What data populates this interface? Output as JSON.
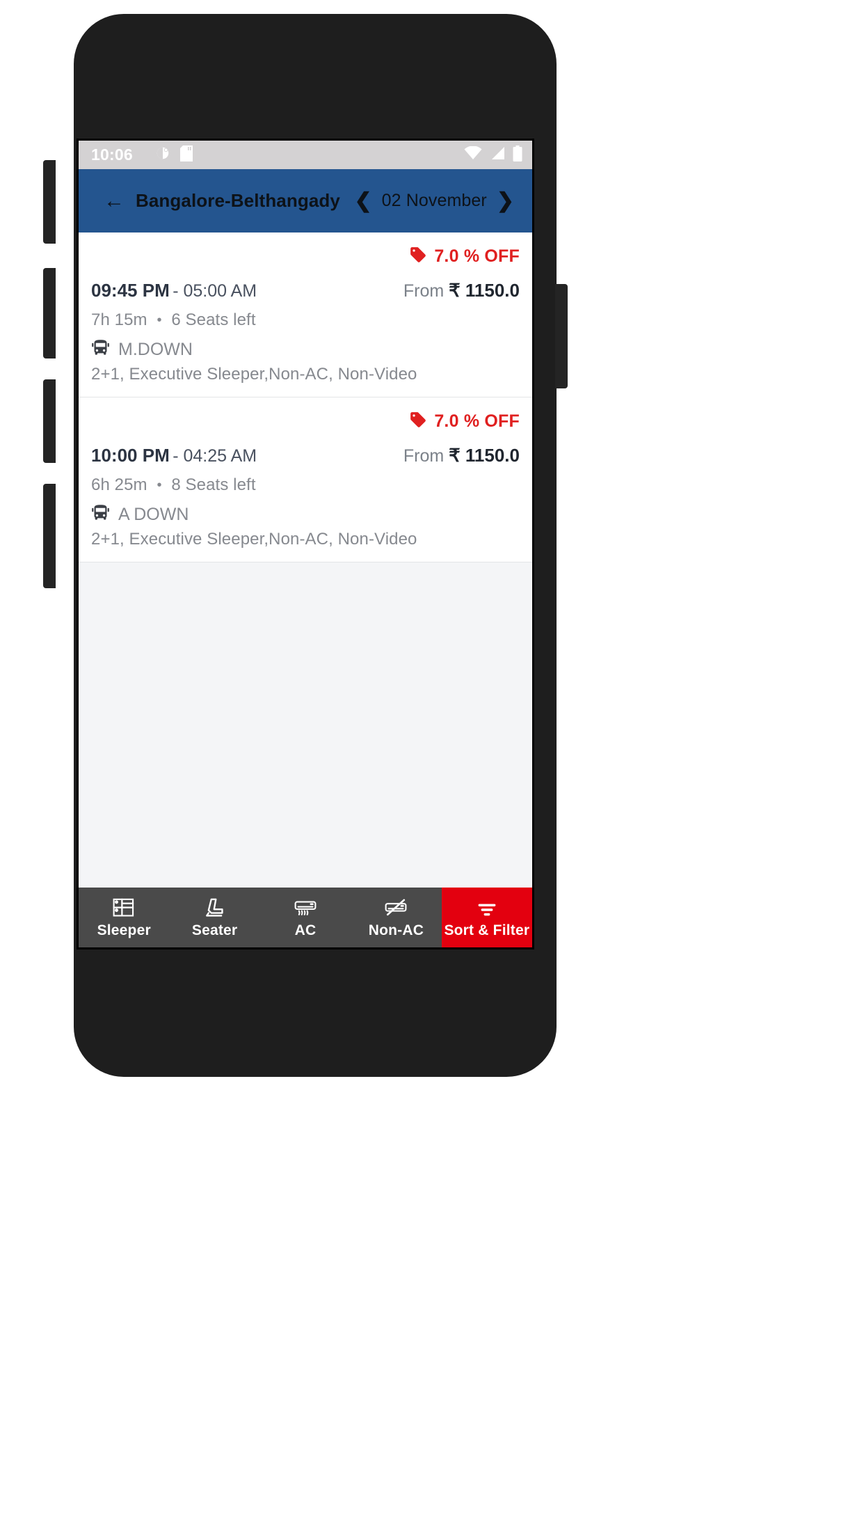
{
  "statusbar": {
    "time": "10:06",
    "left_icons": [
      "screen-rotation-icon",
      "sd-card-icon"
    ],
    "right_icons": [
      "wifi-icon",
      "cell-signal-icon",
      "battery-icon"
    ]
  },
  "appbar": {
    "back_icon": "back-arrow-icon",
    "title": "Bangalore-Belthangady",
    "prev_icon": "chevron-left-icon",
    "date": "02 November",
    "next_icon": "chevron-right-icon",
    "background_color": "#24558f"
  },
  "results": [
    {
      "offer_icon": "discount-tag-icon",
      "offer": "7.0 % OFF",
      "departure": "09:45 PM",
      "arrival": "- 05:00 AM",
      "price_prefix": "From",
      "price": "₹ 1150.0",
      "duration": "7h 15m",
      "separator": "•",
      "seats": "6 Seats left",
      "bus_icon": "bus-icon",
      "operator": "M.DOWN",
      "amenities": "2+1, Executive Sleeper,Non-AC, Non-Video"
    },
    {
      "offer_icon": "discount-tag-icon",
      "offer": "7.0 % OFF",
      "departure": "10:00 PM",
      "arrival": "- 04:25 AM",
      "price_prefix": "From",
      "price": "₹ 1150.0",
      "duration": "6h 25m",
      "separator": "•",
      "seats": "8 Seats left",
      "bus_icon": "bus-icon",
      "operator": "A DOWN",
      "amenities": "2+1, Executive Sleeper,Non-AC, Non-Video"
    }
  ],
  "filterbar": {
    "items": [
      {
        "label": "Sleeper",
        "icon": "sleeper-berth-icon"
      },
      {
        "label": "Seater",
        "icon": "seat-icon"
      },
      {
        "label": "AC",
        "icon": "air-conditioner-icon"
      },
      {
        "label": "Non-AC",
        "icon": "air-conditioner-off-icon"
      }
    ],
    "primary": {
      "label": "Sort & Filter",
      "icon": "filter-icon",
      "color": "#e3000f"
    }
  },
  "navbar": {
    "back": "nav-back-icon",
    "home": "nav-home-icon",
    "recents": "nav-recents-icon"
  }
}
